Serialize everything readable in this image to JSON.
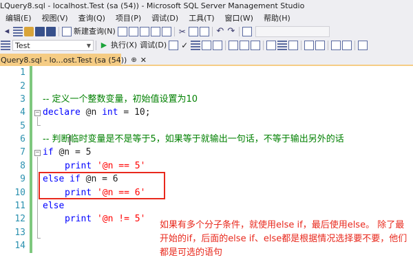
{
  "window": {
    "title": "LQuery8.sql - localhost.Test (sa (54)) - Microsoft SQL Server Management Studio"
  },
  "menu": [
    "编辑(E)",
    "视图(V)",
    "查询(Q)",
    "项目(P)",
    "调试(D)",
    "工具(T)",
    "窗口(W)",
    "帮助(H)"
  ],
  "toolbar": {
    "new_query_label": "新建查询(N)",
    "execute_label": "执行(X)",
    "debug_label": "调试(D)",
    "database": "Test"
  },
  "tab": {
    "label": "Query8.sql - lo...ost.Test (sa (54))",
    "pin_glyph": "⊕",
    "close_glyph": "✕"
  },
  "editor": {
    "line_numbers": [
      "1",
      "2",
      "3",
      "4",
      "5",
      "6",
      "7",
      "8",
      "9",
      "10",
      "11",
      "12",
      "13",
      "14"
    ],
    "lines": {
      "l3_comment": "-- 定义一个整数变量，初始值设置为10",
      "l4_kw": "declare",
      "l4_rest": " @n ",
      "l4_type": "int",
      "l4_eq": " = 10;",
      "l6_comment": "-- 判断临时变量是不是等于5，如果等于就输出一句话，不等于输出另外的话",
      "l7_kw": "if",
      "l7_rest": " @n = 5",
      "l8_kw": "print",
      "l8_str": "'@n == 5'",
      "l9_kw": "else if",
      "l9_rest": " @n = 6",
      "l10_kw": "print",
      "l10_str": "'@n == 6'",
      "l11_kw": "else",
      "l12_kw": "print",
      "l12_str": "'@n != 5'"
    }
  },
  "annotation": {
    "text": "如果有多个分子条件，就使用else if，最后使用else。 除了最开始的if，后面的else if、else都是根据情况选择要不要，他们都是可选的语句"
  },
  "colors": {
    "keyword": "#0000ff",
    "comment": "#008000",
    "string": "#ff0000",
    "line_number": "#2b91af",
    "annotation": "#e8281c",
    "tab_active": "#f5cc84"
  }
}
